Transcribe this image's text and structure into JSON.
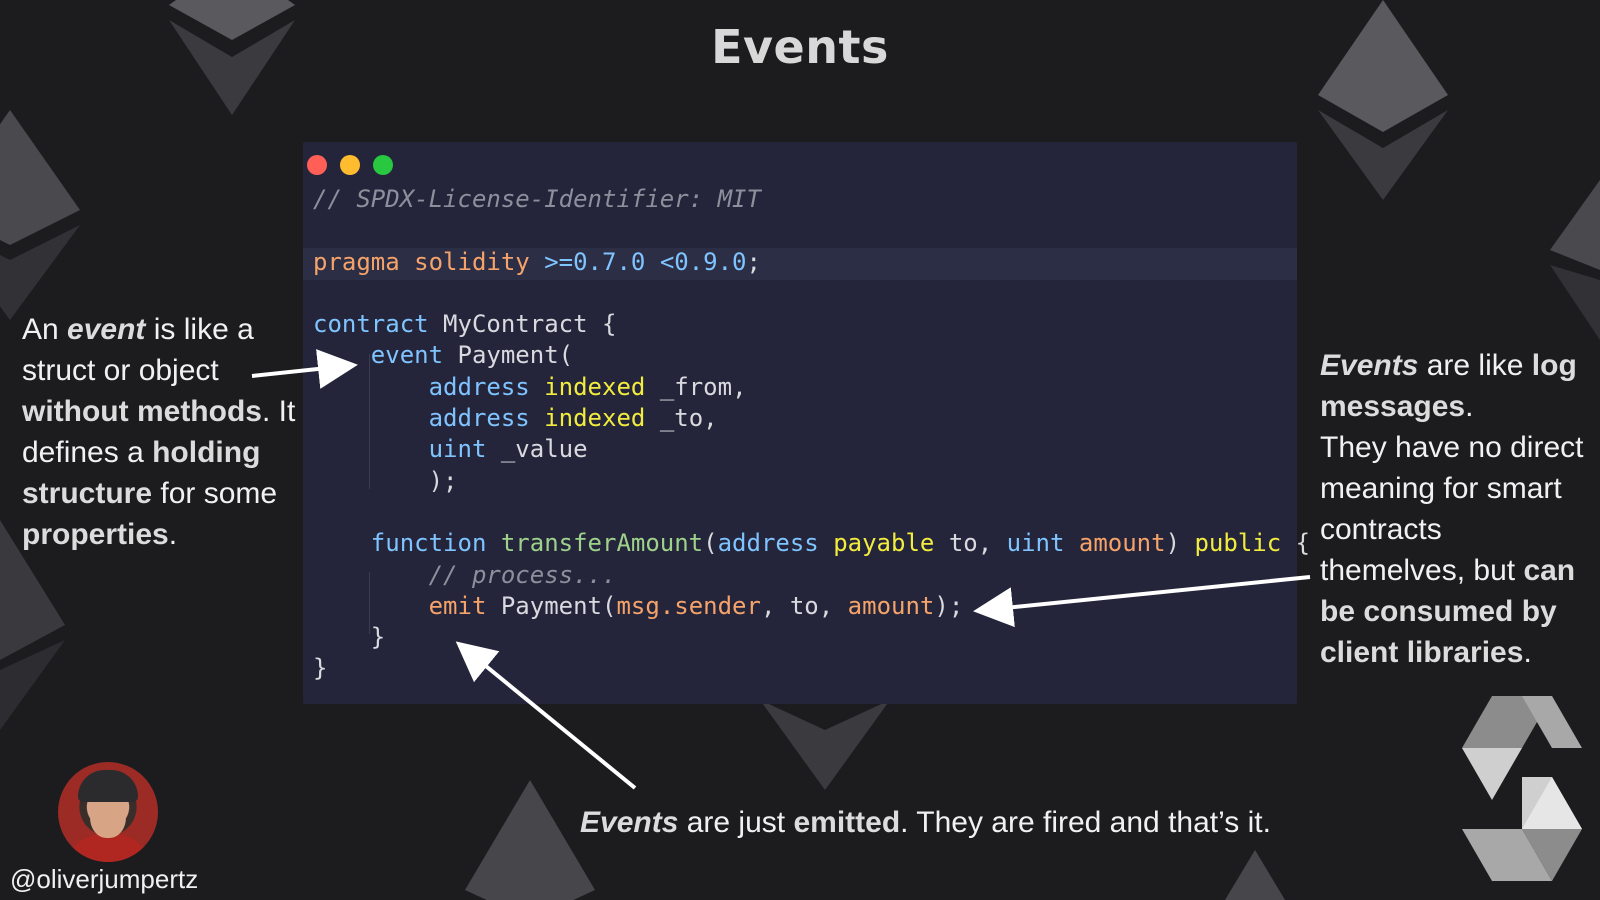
{
  "slide": {
    "title": "Events"
  },
  "code_window": {
    "lines": [
      "// SPDX-License-Identifier: MIT",
      "",
      "pragma solidity >=0.7.0 <0.9.0;",
      "",
      "contract MyContract {",
      "    event Payment(",
      "        address indexed _from,",
      "        address indexed _to,",
      "        uint _value",
      "        );",
      "",
      "    function transferAmount(address payable to, uint amount) public {",
      "        // process...",
      "        emit Payment(msg.sender, to, amount);",
      "    }",
      "}"
    ]
  },
  "notes": {
    "left": {
      "p1": "An ",
      "p2": "event",
      "p3": " is like a struct or object ",
      "p4": "without methods",
      "p5": ". It defines a ",
      "p6": "holding structure",
      "p7": " for some ",
      "p8": "properties",
      "p9": "."
    },
    "right": {
      "p1": "Events",
      "p2": " are like ",
      "p3": "log messages",
      "p4": ".",
      "p5": "They have ",
      "p6": "no direct meaning for smart contracts",
      "p7": "themelves, but ",
      "p8": "can be consumed by client libraries",
      "p9": "."
    },
    "bottom": {
      "p1": "Events",
      "p2": " are just ",
      "p3": "emitted",
      "p4": ". They are fired and that’s it."
    }
  },
  "author": {
    "handle": "@oliverjumpertz"
  },
  "colors": {
    "background": "#1c1c1f",
    "code_background": "#24253a",
    "keyword": "#f5a36a",
    "type": "#7fc4ff",
    "modifier": "#f2ec3f"
  }
}
